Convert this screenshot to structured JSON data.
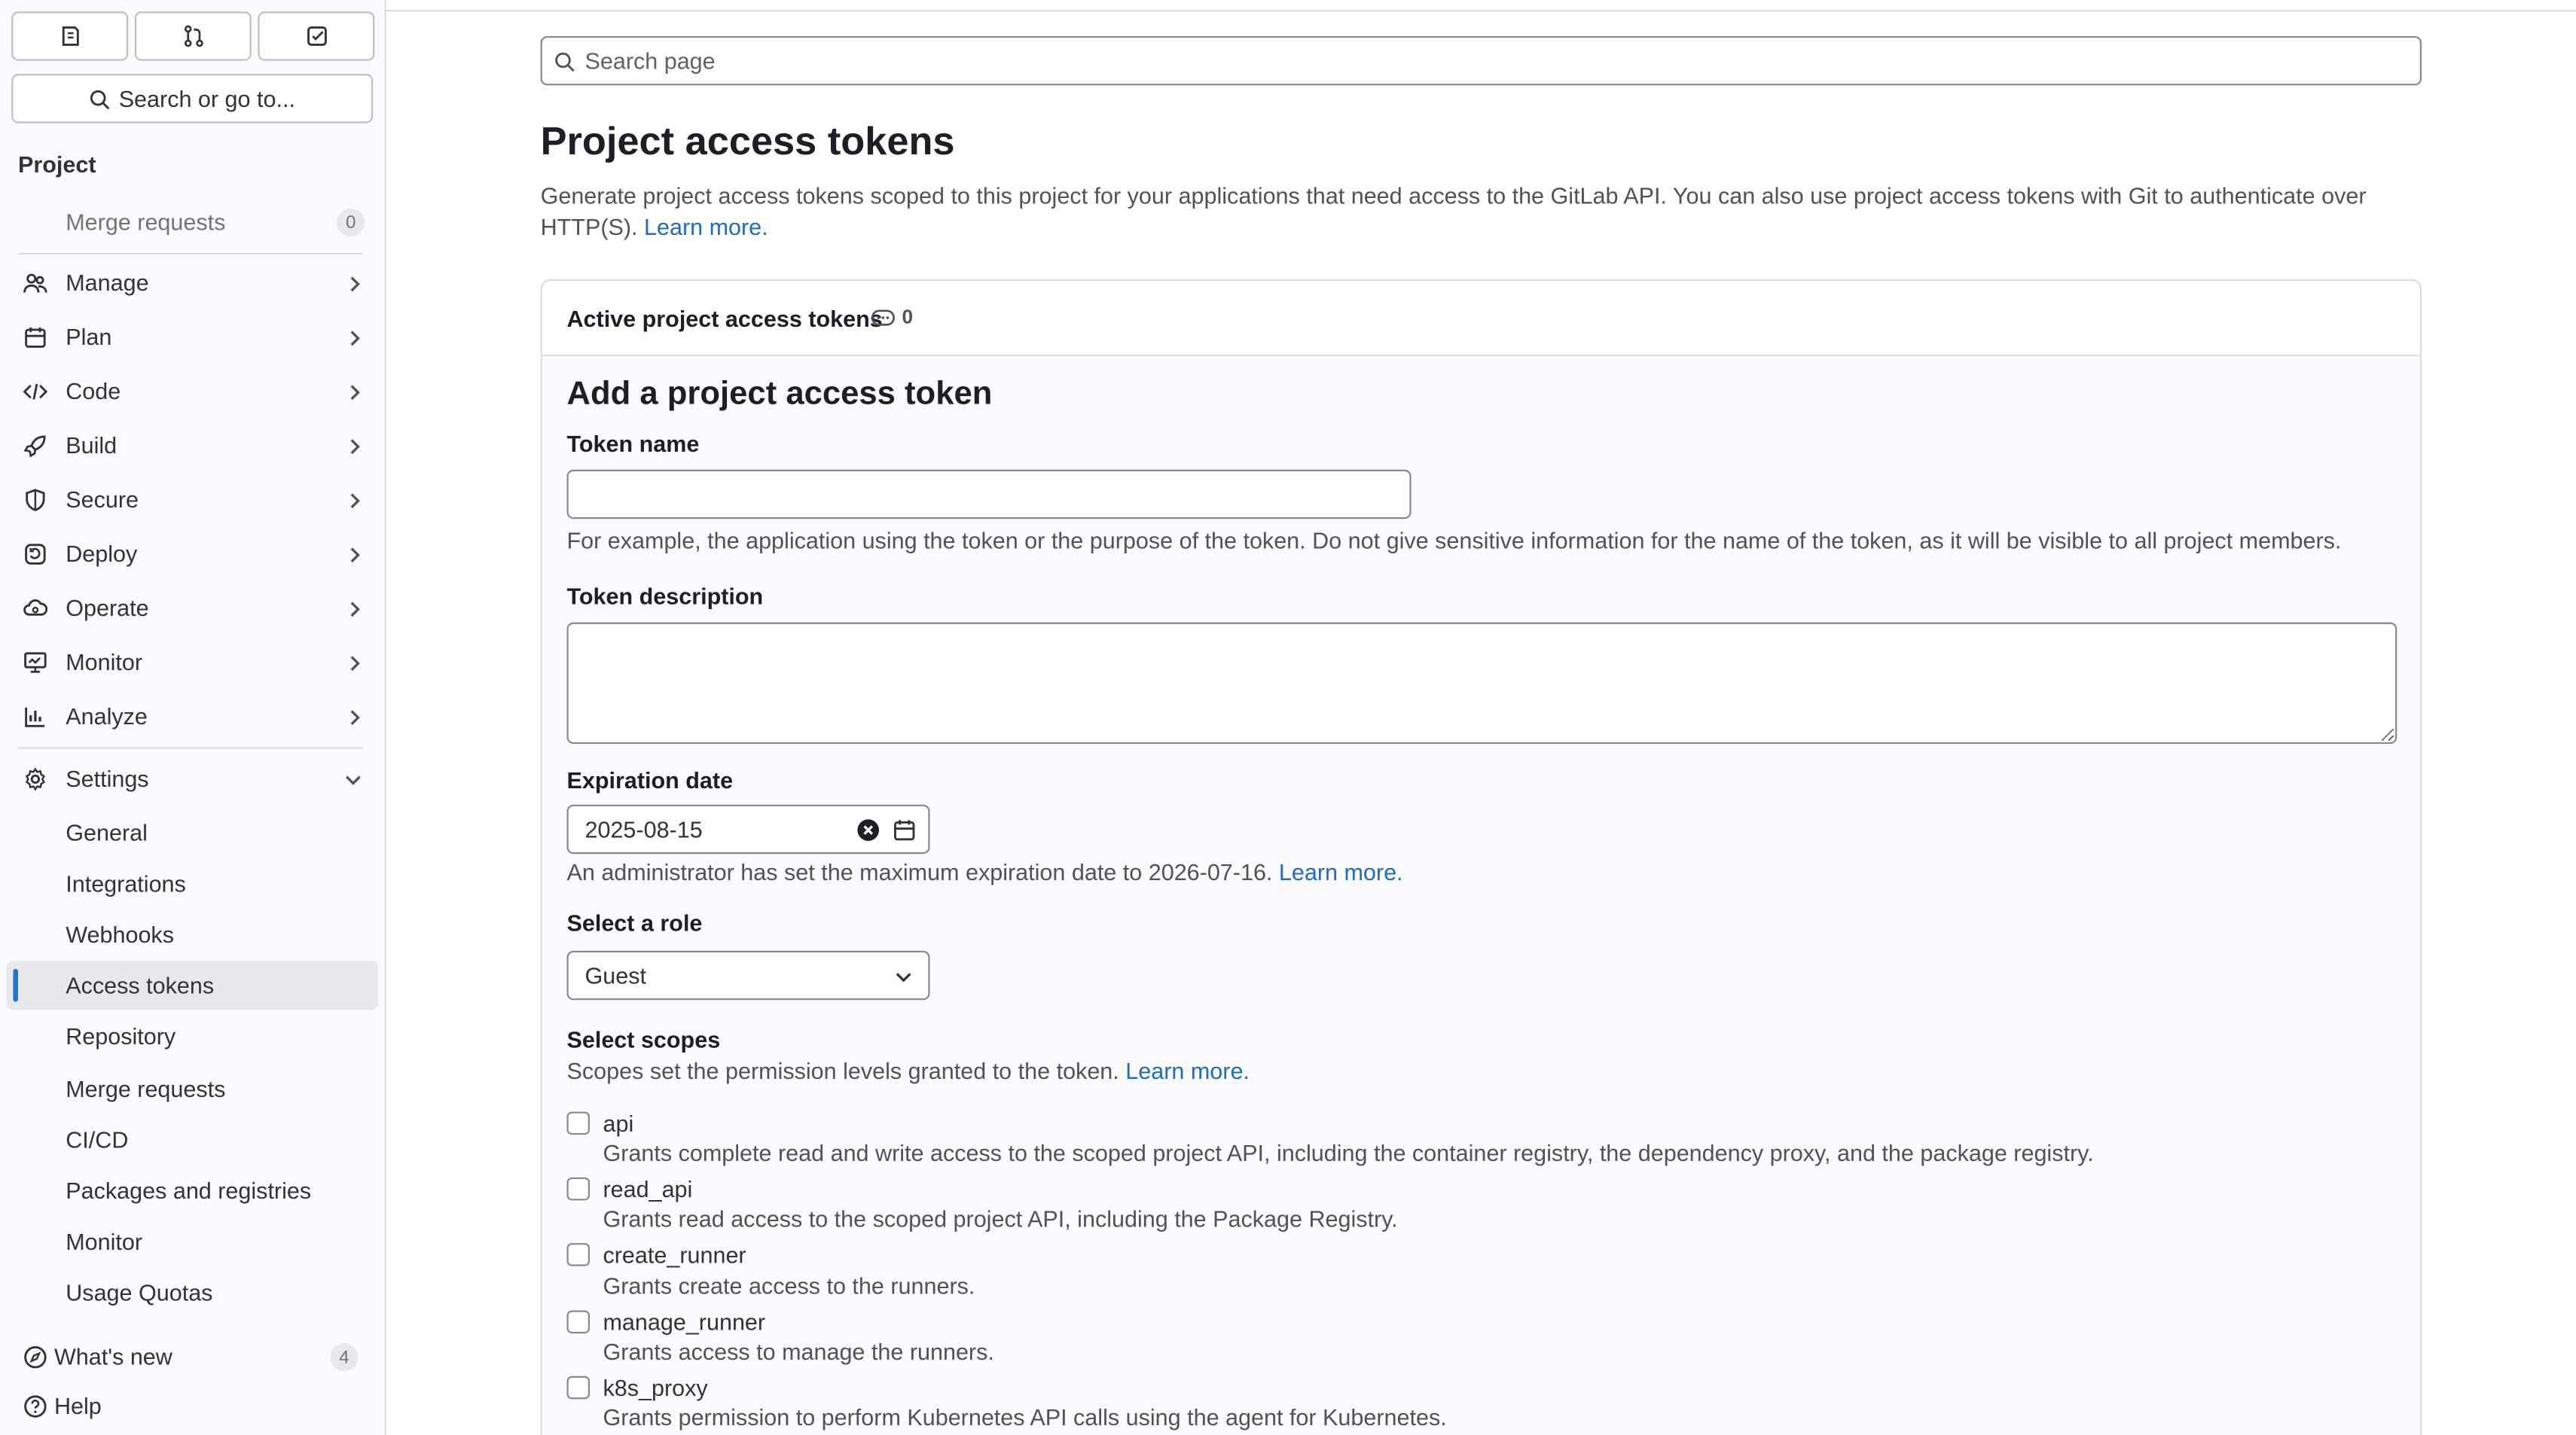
{
  "sidebar": {
    "search_label": "Search or go to...",
    "section_label": "Project",
    "merge_requests": {
      "label": "Merge requests",
      "count": "0"
    },
    "groups": [
      {
        "label": "Manage",
        "icon": "users-icon"
      },
      {
        "label": "Plan",
        "icon": "calendar-icon"
      },
      {
        "label": "Code",
        "icon": "code-icon"
      },
      {
        "label": "Build",
        "icon": "rocket-icon"
      },
      {
        "label": "Secure",
        "icon": "shield-icon"
      },
      {
        "label": "Deploy",
        "icon": "deploy-icon"
      },
      {
        "label": "Operate",
        "icon": "cloud-gear-icon"
      },
      {
        "label": "Monitor",
        "icon": "monitor-icon"
      },
      {
        "label": "Analyze",
        "icon": "chart-icon"
      }
    ],
    "settings": {
      "label": "Settings",
      "items": [
        "General",
        "Integrations",
        "Webhooks",
        "Access tokens",
        "Repository",
        "Merge requests",
        "CI/CD",
        "Packages and registries",
        "Monitor",
        "Usage Quotas"
      ],
      "active": "Access tokens"
    },
    "whats_new": {
      "label": "What's new",
      "count": "4"
    },
    "help": "Help"
  },
  "main": {
    "search_placeholder": "Search page",
    "title": "Project access tokens",
    "intro_text": "Generate project access tokens scoped to this project for your applications that need access to the GitLab API. You can also use project access tokens with Git to authenticate over HTTP(S).",
    "learn_more": "Learn more.",
    "active_tokens": {
      "label": "Active project access tokens",
      "count": "0"
    },
    "form": {
      "heading": "Add a project access token",
      "token_name_label": "Token name",
      "token_name_value": "",
      "token_name_help": "For example, the application using the token or the purpose of the token. Do not give sensitive information for the name of the token, as it will be visible to all project members.",
      "token_description_label": "Token description",
      "token_description_value": "",
      "expiration_label": "Expiration date",
      "expiration_value": "2025-08-15",
      "expiration_help": "An administrator has set the maximum expiration date to 2026-07-16.",
      "role_label": "Select a role",
      "role_value": "Guest",
      "scopes_label": "Select scopes",
      "scopes_help": "Scopes set the permission levels granted to the token.",
      "scopes": [
        {
          "name": "api",
          "desc": "Grants complete read and write access to the scoped project API, including the container registry, the dependency proxy, and the package registry.",
          "checked": false
        },
        {
          "name": "read_api",
          "desc": "Grants read access to the scoped project API, including the Package Registry.",
          "checked": false
        },
        {
          "name": "create_runner",
          "desc": "Grants create access to the runners.",
          "checked": false
        },
        {
          "name": "manage_runner",
          "desc": "Grants access to manage the runners.",
          "checked": false
        },
        {
          "name": "k8s_proxy",
          "desc": "Grants permission to perform Kubernetes API calls using the agent for Kubernetes.",
          "checked": false
        }
      ]
    }
  }
}
